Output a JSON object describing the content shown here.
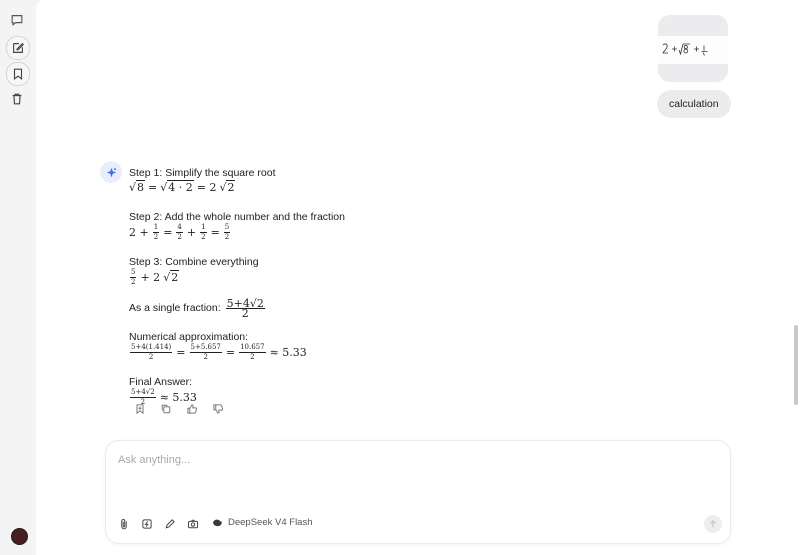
{
  "sidebar": {
    "icons": [
      "chat-bubble-icon",
      "compose-icon",
      "bookmark-icon",
      "trash-icon"
    ]
  },
  "conversation": {
    "user_image_formula": "2 + √8 + 1/2",
    "user_message": "calculation",
    "steps": [
      {
        "heading": "Step 1: Simplify the square root"
      },
      {
        "heading": "Step 2: Add the whole number and the fraction"
      },
      {
        "heading": "Step 3: Combine everything"
      },
      {
        "heading": "As a single fraction:"
      },
      {
        "heading": "Numerical approximation:"
      },
      {
        "heading": "Final Answer:"
      }
    ],
    "math": {
      "m1_a": "√",
      "m1_b": "8",
      "m1_c": "=",
      "m1_d": "4 · 2",
      "m1_e": "= 2",
      "m1_f": "2",
      "m2_a": "2 +",
      "m2_b": "1",
      "m2_c": "2",
      "m2_d": "=",
      "m2_e": "4",
      "m2_f": "2",
      "m2_g": "+",
      "m2_h": "1",
      "m2_i": "2",
      "m2_j": "=",
      "m2_k": "5",
      "m2_l": "2",
      "m3_a": "5",
      "m3_b": "2",
      "m3_c": "+ 2",
      "m3_d": "2",
      "m4_num": "5+4√2",
      "m4_den": "2",
      "m5_a_num": "5+4(1.414)",
      "m5_a_den": "2",
      "m5_eq1": "=",
      "m5_b_num": "5+5.657",
      "m5_b_den": "2",
      "m5_eq2": "=",
      "m5_c_num": "10.657",
      "m5_c_den": "2",
      "m5_tail": "≈ 5.33",
      "m6_num": "5+4√2",
      "m6_den": "2",
      "m6_tail": "≈ 5.33"
    },
    "actions": [
      "bookmark-icon",
      "copy-icon",
      "thumbs-up-icon",
      "thumbs-down-icon"
    ]
  },
  "composer": {
    "placeholder": "Ask anything...",
    "value": "",
    "model_label": "DeepSeek V4 Flash"
  },
  "colors": {
    "accent": "#3b6ff5",
    "avatar": "#4a1e1e"
  }
}
